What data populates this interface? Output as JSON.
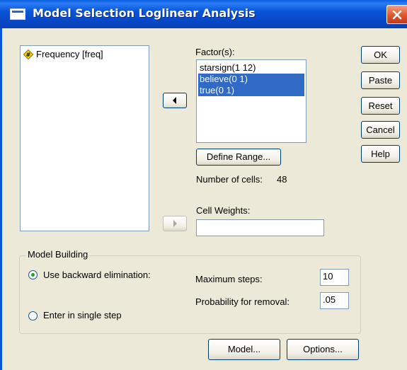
{
  "window": {
    "title": "Model Selection Loglinear Analysis"
  },
  "variables": [
    {
      "label": "Frequency [freq]",
      "icon": "scale-variable-icon"
    }
  ],
  "factors": {
    "label": "Factor(s):",
    "items": [
      {
        "label": "starsign(1 12)",
        "selected": false
      },
      {
        "label": "believe(0 1)",
        "selected": true
      },
      {
        "label": "true(0 1)",
        "selected": true
      }
    ]
  },
  "define_range": {
    "label": "Define Range..."
  },
  "cells": {
    "label": "Number of cells:",
    "value": "48"
  },
  "cell_weights": {
    "label": "Cell Weights:",
    "value": ""
  },
  "buttons": {
    "ok": "OK",
    "paste": "Paste",
    "reset": "Reset",
    "cancel": "Cancel",
    "help": "Help",
    "model": "Model...",
    "options": "Options..."
  },
  "model_building": {
    "title": "Model Building",
    "backward": "Use backward elimination:",
    "single": "Enter in single step",
    "selected": "backward",
    "max_steps_label": "Maximum steps:",
    "max_steps_value": "10",
    "prob_label": "Probability for removal:",
    "prob_value": ".05"
  }
}
